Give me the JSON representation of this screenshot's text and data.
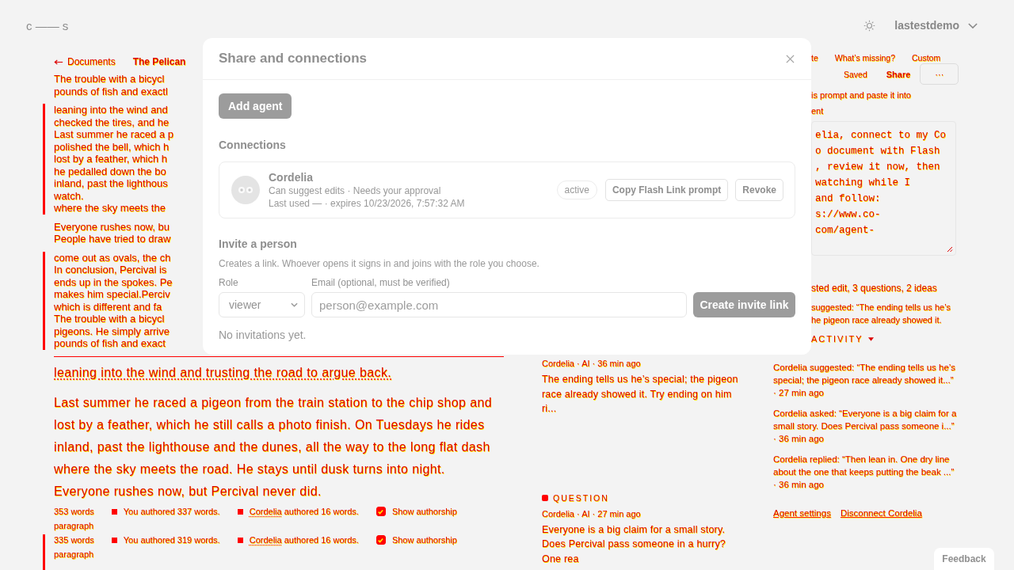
{
  "header": {
    "logo": "c —— s",
    "account": "lastestdemo"
  },
  "document": {
    "back_link": "Documents",
    "title": "The Pelican",
    "fragments": [
      {
        "marked": false,
        "lines": [
          "The trouble with a bicycl",
          "pounds of fish and exactl"
        ]
      },
      {
        "marked": true,
        "lines": [
          "leaning into the wind and",
          "checked the tires, and he",
          "Last summer he raced a p",
          "polished the bell, which h",
          "lost by a feather, which h",
          "he pedalled down the bo",
          "inland, past the lighthous",
          "watch.",
          "where the sky meets the"
        ]
      },
      {
        "marked": false,
        "lines": [
          "Everyone rushes now, bu",
          "People have tried to draw"
        ]
      },
      {
        "marked": true,
        "lines": [
          "come out as ovals, the ch",
          "In conclusion, Percival is",
          "ends up in the spokes. Pe",
          "makes him special.Perciv",
          "which is different and fa",
          "The trouble with a bicycl",
          "pigeons. He simply arrive",
          "pounds of fish and exact"
        ]
      }
    ],
    "paragraphs": [
      {
        "text": "leaning into the wind and trusting the road to argue back.",
        "highlighted": true
      },
      {
        "text": "Last summer he raced a pigeon from the train station to the chip shop and lost by a feather, which he still calls a photo finish. On Tuesdays he rides inland, past the lighthouse and the dunes, all the way to the long flat dash where the sky meets the road. He stays until dusk turns into night.",
        "highlighted": false
      },
      {
        "text": "Everyone rushes now, but Percival never did.",
        "highlighted": false
      }
    ],
    "status_bars": [
      {
        "marked": false,
        "words": "353 words",
        "you": "You authored 337 words.",
        "agent_name": "Cordelia",
        "agent_rest": "authored 16 words.",
        "toggle_label": "Show authorship",
        "show_authorship": true,
        "block_type": "paragraph"
      },
      {
        "marked": true,
        "words": "335 words",
        "you": "You authored 319 words.",
        "agent_name": "Cordelia",
        "agent_rest": "authored 16 words.",
        "toggle_label": "Show authorship",
        "show_authorship": true,
        "block_type": "paragraph"
      }
    ]
  },
  "comments": [
    {
      "meta": "Cordelia · AI · 36 min ago",
      "text": "The ending tells us he’s special; the pigeon race already showed it. Try ending on him ri..."
    },
    {
      "label": "QUESTION",
      "meta": "Cordelia · AI · 27 min ago",
      "text": "Everyone is a big claim for a small story. Does Percival pass someone in a hurry? One rea"
    }
  ],
  "agent_panel": {
    "presets": [
      "te",
      "What’s missing?",
      "Custom"
    ],
    "save_status": "Saved",
    "share": "Share",
    "more": "···",
    "instructions": [
      "is prompt and paste it into",
      "ent"
    ],
    "prompt_lines": [
      "elia, connect to my Co",
      "o document with Flash",
      ", review it now, then",
      "watching while I",
      "and follow:",
      "s://www.co-",
      "com/agent-"
    ],
    "summary": "sted edit, 3 questions, 2 ideas",
    "latest": [
      "suggested: “The ending tells us he’s",
      "he pigeon race already showed it."
    ],
    "activity_heading": "ACTIVITY",
    "activity": [
      {
        "text": "Cordelia suggested: “The ending tells us he’s special; the pigeon race already showed it...”",
        "time": "· 27 min ago"
      },
      {
        "text": "Cordelia asked: “Everyone is a big claim for a small story. Does Percival pass someone i...”",
        "time": "· 36 min ago"
      },
      {
        "text": "Cordelia replied: “Then lean in. One dry line about the one that keeps putting the beak ...”",
        "time": "· 36 min ago"
      }
    ],
    "links": [
      "Agent settings",
      "Disconnect Cordelia"
    ]
  },
  "dialog": {
    "title": "Share and connections",
    "add_agent": "Add agent",
    "connections_heading": "Connections",
    "connections": [
      {
        "name": "Cordelia",
        "permissions": "Can suggest edits · Needs your approval",
        "usage": "Last used — · expires 10/23/2026, 7:57:32 AM",
        "status": "active",
        "copy": "Copy Flash Link prompt",
        "revoke": "Revoke"
      }
    ],
    "invite_heading": "Invite a person",
    "invite_description": "Creates a link. Whoever opens it signs in and joins with the role you choose.",
    "role_label": "Role",
    "role": "viewer",
    "email_label": "Email (optional, must be verified)",
    "email_placeholder": "person@example.com",
    "create": "Create invite link",
    "empty": "No invitations yet."
  },
  "feedback": "Feedback"
}
